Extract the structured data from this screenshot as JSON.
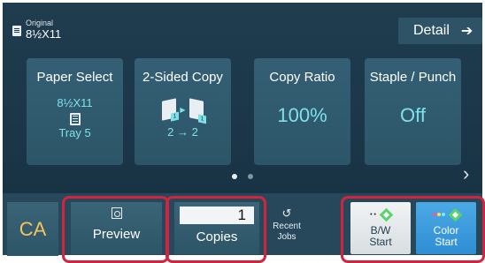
{
  "original": {
    "label": "Original",
    "size": "8½X11",
    "icon": "original-document-icon"
  },
  "detail": {
    "label": "Detail",
    "icon": "arrow-right-icon"
  },
  "tiles": {
    "paper_select": {
      "title": "Paper Select",
      "size": "8½X11",
      "tray": "Tray 5",
      "icon": "paper-tray-icon"
    },
    "two_sided": {
      "title": "2-Sided Copy",
      "mode": "2 → 2",
      "icon": "duplex-icon"
    },
    "copy_ratio": {
      "title": "Copy Ratio",
      "value": "100%"
    },
    "staple_punch": {
      "title": "Staple / Punch",
      "value": "Off"
    }
  },
  "pager": {
    "pages": 2,
    "active": 1,
    "next_icon": "chevron-right-icon"
  },
  "bottom": {
    "ca": "CA",
    "preview": {
      "label": "Preview",
      "icon": "preview-icon"
    },
    "copies": {
      "value": "1",
      "label": "Copies"
    },
    "recent_jobs": {
      "label": "Recent\nJobs",
      "icon": "recent-jobs-icon"
    },
    "bw_start": {
      "label": "B/W\nStart",
      "icon": "start-diamond-icon"
    },
    "color_start": {
      "label": "Color\nStart",
      "icon": "start-diamond-icon"
    }
  },
  "colors": {
    "panel": "#1f3d4f",
    "tile": "#345f74",
    "accent_text": "#7ee0e8",
    "highlight": "#d0243f",
    "ca_text": "#f6c35a",
    "color_start": "#3a9be0"
  }
}
